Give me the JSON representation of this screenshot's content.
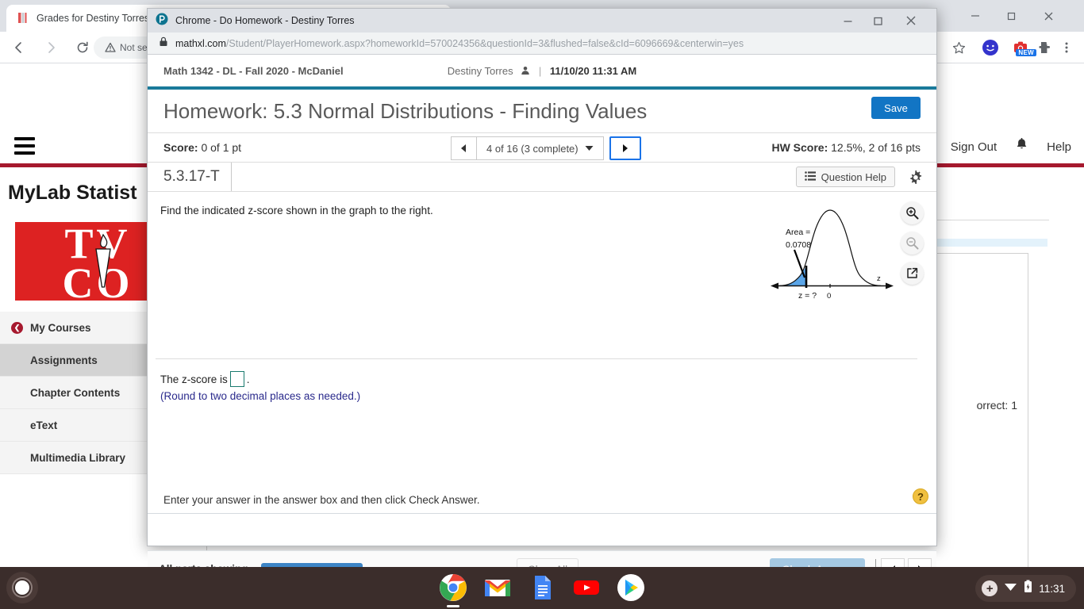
{
  "background_browser": {
    "tab": {
      "title": "Grades for Destiny Torres:",
      "favicon": "bookmark-icon"
    },
    "window_controls": {
      "minimize": "—",
      "maximize": "❐",
      "close": "✕"
    },
    "toolbar": {
      "back": "←",
      "forward": "→",
      "reload": "⟳",
      "security_label": "Not sec",
      "bookmark_icon": "star-icon",
      "profile_icon": "avatar-icon",
      "new_badge": "NEW",
      "extensions_icon": "puzzle-icon",
      "menu_icon": "three-dot-icon"
    },
    "page": {
      "brand": "MyLab Statist",
      "logo_letters": "TV\nCO",
      "top_links": [
        "Sign Out",
        "Help"
      ],
      "notification_icon": "bell-icon",
      "sidebar": [
        {
          "label": "My Courses",
          "active": false,
          "has_back": true
        },
        {
          "label": "Assignments",
          "active": true,
          "has_back": false
        },
        {
          "label": "Chapter Contents",
          "active": false,
          "has_back": false
        },
        {
          "label": "eText",
          "active": false,
          "has_back": false
        },
        {
          "label": "Multimedia Library",
          "active": false,
          "has_back": false
        }
      ],
      "correct_text": "orrect: 1"
    }
  },
  "popup": {
    "titlebar": {
      "title": "Chrome - Do Homework - Destiny Torres",
      "favicon": "pearson-icon",
      "minimize": "—",
      "maximize": "❐",
      "close": "✕"
    },
    "url": {
      "lock_icon": "lock-icon",
      "domain": "mathxl.com",
      "path": "/Student/PlayerHomework.aspx?homeworkId=570024356&questionId=3&flushed=false&cId=6096669&centerwin=yes"
    },
    "header": {
      "course": "Math 1342 - DL - Fall 2020 - McDaniel",
      "user_name": "Destiny Torres",
      "user_icon": "person-icon",
      "separator": "|",
      "datetime": "11/10/20 11:31 AM"
    },
    "homework": {
      "title": "Homework: 5.3 Normal Distributions - Finding Values",
      "save_label": "Save",
      "score_label": "Score:",
      "score_value": "0 of 1 pt",
      "nav_prev_icon": "left-triangle-icon",
      "nav_position": "4 of 16 (3 complete)",
      "nav_dropdown_icon": "caret-down-icon",
      "nav_next_icon": "right-triangle-icon",
      "hw_score_label": "HW Score:",
      "hw_score_value": "12.5%, 2 of 16 pts"
    },
    "question": {
      "id": "5.3.17-T",
      "help_label": "Question Help",
      "help_icon": "list-icon",
      "gear_icon": "gear-icon",
      "prompt": "Find the indicated z-score shown in the graph to the right.",
      "zoom_in_icon": "zoom-in-icon",
      "zoom_out_icon": "zoom-out-icon",
      "popout_icon": "external-link-icon",
      "answer_prefix": "The z-score is",
      "answer_suffix": ".",
      "answer_value": "",
      "answer_note": "(Round to two decimal places as needed.)"
    },
    "footer": {
      "note": "Enter your answer in the answer box and then click Check Answer.",
      "help_bubble": "?",
      "all_parts": "All parts showing",
      "clear_all": "Clear All",
      "check_answer": "Check Answer",
      "page_prev_icon": "left-triangle-icon",
      "page_next_icon": "right-triangle-icon"
    }
  },
  "shelf": {
    "launcher_icon": "launcher-icon",
    "apps": [
      "chrome-icon",
      "gmail-icon",
      "docs-icon",
      "youtube-icon",
      "play-store-icon"
    ],
    "tray": {
      "accessibility_icon": "plus-circle-icon",
      "wifi_icon": "wifi-icon",
      "battery_icon": "battery-icon",
      "clock": "11:31"
    }
  },
  "chart_data": {
    "type": "area",
    "title": "",
    "xlabel": "z",
    "ylabel": "",
    "annotations": [
      {
        "text": "Area =",
        "role": "area-label-line1"
      },
      {
        "text": "0.0708",
        "role": "area-label-line2"
      },
      {
        "text": "z = ?",
        "role": "x-tick-unknown"
      },
      {
        "text": "0",
        "role": "x-tick-mean"
      },
      {
        "text": "z",
        "role": "axis-label"
      }
    ],
    "shaded_area": 0.0708,
    "shaded_region": "left tail, from -infinity to z",
    "mean": 0,
    "z_unknown": true,
    "curve": "standard normal density",
    "shade_color": "#5aa5e8",
    "curve_color": "#000000",
    "grid": false,
    "legend": false
  },
  "colors": {
    "accent_blue": "#1275c4",
    "teal_rule": "#1a7a9a",
    "crimson": "#a6192e",
    "progress": "#3d85c6",
    "shelf": "#3b2d2b",
    "note_text": "#2a2a8c"
  }
}
